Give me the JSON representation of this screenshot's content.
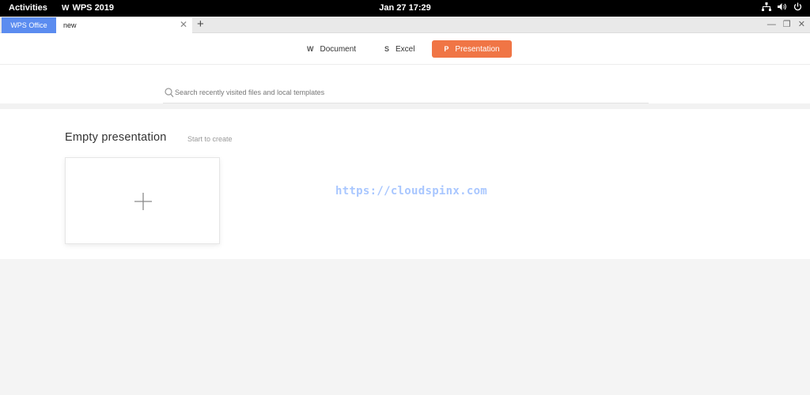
{
  "topbar": {
    "activities": "Activities",
    "app_name": "WPS 2019",
    "app_logo": "W",
    "clock": "Jan 27  17:29",
    "tray_icons": [
      "network-icon",
      "volume-icon",
      "power-icon"
    ]
  },
  "tabs": {
    "home_tab": "WPS Office",
    "doc_tab": "new",
    "close_glyph": "✕",
    "add_glyph": "+"
  },
  "window_controls": {
    "minimize": "—",
    "restore": "❐",
    "close": "✕"
  },
  "modes": {
    "document": {
      "icon": "W",
      "label": "Document"
    },
    "excel": {
      "icon": "S",
      "label": "Excel"
    },
    "presentation": {
      "icon": "P",
      "label": "Presentation"
    },
    "active": "presentation",
    "accent_color": "#f07545"
  },
  "search": {
    "placeholder": "Search recently visited files and local templates"
  },
  "section": {
    "title": "Empty presentation",
    "subtitle": "Start to create"
  },
  "watermark": "https://cloudspinx.com",
  "colors": {
    "home_tab": "#5b8cf0",
    "watermark": "#a9c7ff"
  }
}
